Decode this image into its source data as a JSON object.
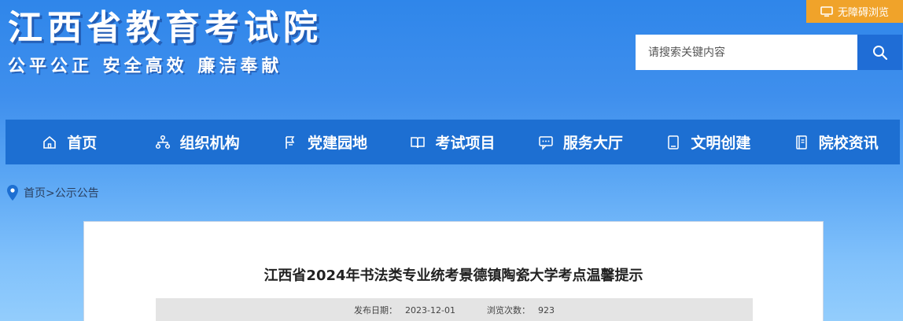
{
  "header": {
    "site_title": "江西省教育考试院",
    "slogan": "公平公正  安全高效  廉洁奉献",
    "accessibility_label": "无障碍浏览",
    "search_placeholder": "请搜索关键内容"
  },
  "nav": {
    "items": [
      {
        "label": "首页",
        "icon": "home-icon"
      },
      {
        "label": "组织机构",
        "icon": "org-chart-icon"
      },
      {
        "label": "党建园地",
        "icon": "flag-icon"
      },
      {
        "label": "考试项目",
        "icon": "book-open-icon"
      },
      {
        "label": "服务大厅",
        "icon": "chat-service-icon"
      },
      {
        "label": "文明创建",
        "icon": "tablet-icon"
      },
      {
        "label": "院校资讯",
        "icon": "document-icon"
      }
    ]
  },
  "breadcrumb": {
    "home": "首页",
    "separator": ">",
    "current": "公示公告"
  },
  "article": {
    "title": "江西省2024年书法类专业统考景德镇陶瓷大学考点温馨提示",
    "publish_label": "发布日期：",
    "publish_date": "2023-12-01",
    "views_label": "浏览次数：",
    "views": "923"
  },
  "colors": {
    "accent": "#1d6fd2",
    "accessibility_btn": "#f0a32a",
    "search_btn": "#1f6dd6"
  }
}
